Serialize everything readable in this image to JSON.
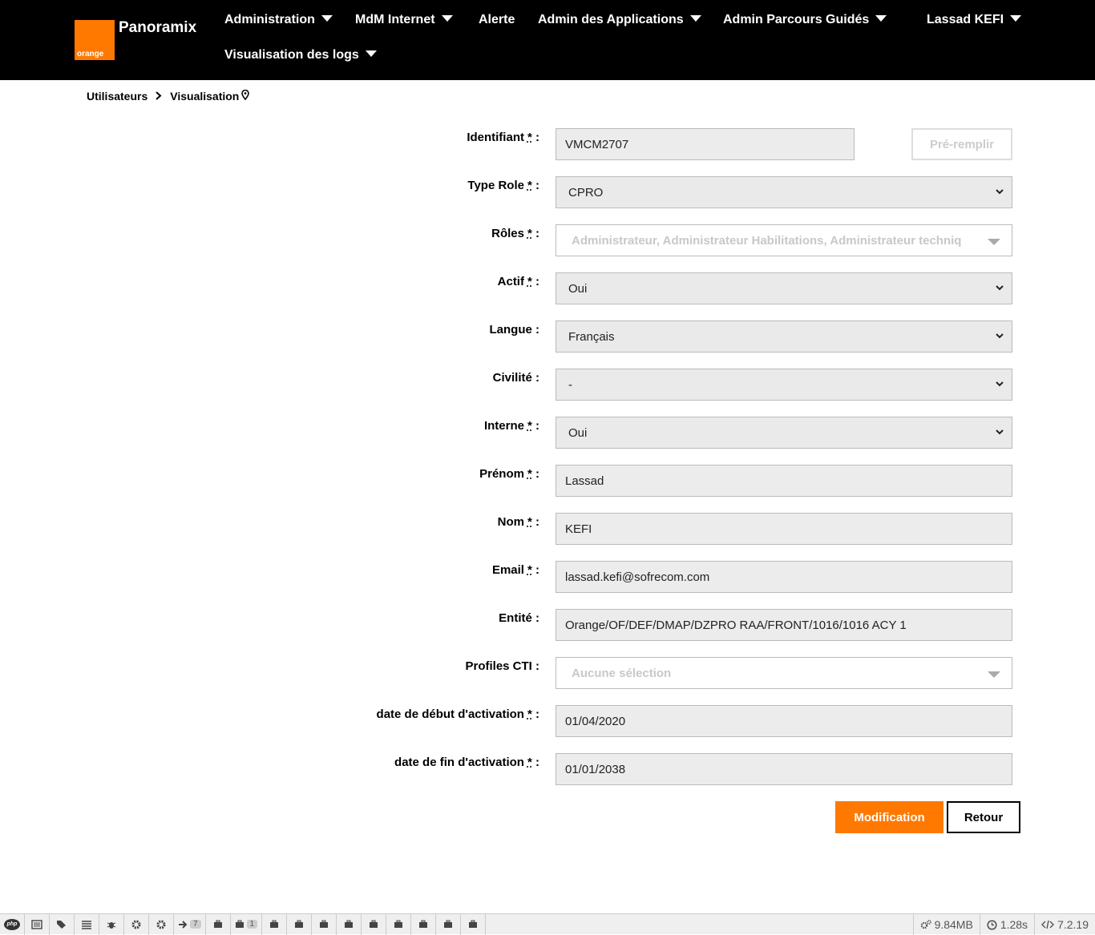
{
  "header": {
    "logo_text": "orange",
    "brand": "Panoramix",
    "nav": [
      {
        "label": "Administration"
      },
      {
        "label": "MdM Internet"
      },
      {
        "label": "Alerte"
      },
      {
        "label": "Admin des Applications"
      },
      {
        "label": "Admin Parcours Guidés"
      },
      {
        "label": "Lassad KEFI"
      },
      {
        "label": "Visualisation des logs"
      }
    ]
  },
  "breadcrumb": {
    "parent": "Utilisateurs",
    "current": "Visualisation"
  },
  "form": {
    "required_mark": "*",
    "fields": {
      "identifiant": {
        "label": "Identifiant",
        "value": "VMCM2707"
      },
      "type_role": {
        "label": "Type Role",
        "value": "CPRO"
      },
      "roles": {
        "label": "Rôles",
        "value": "Administrateur, Administrateur Habilitations, Administrateur techniq"
      },
      "actif": {
        "label": "Actif",
        "value": "Oui"
      },
      "langue": {
        "label": "Langue :",
        "value": "Français"
      },
      "civilite": {
        "label": "Civilité :",
        "value": "-"
      },
      "interne": {
        "label": "Interne",
        "value": "Oui"
      },
      "prenom": {
        "label": "Prénom",
        "value": "Lassad"
      },
      "nom": {
        "label": "Nom",
        "value": "KEFI"
      },
      "email": {
        "label": "Email",
        "value": "lassad.kefi@sofrecom.com"
      },
      "entite": {
        "label": "Entité :",
        "value": "Orange/OF/DEF/DMAP/DZPRO RAA/FRONT/1016/1016 ACY 1"
      },
      "profiles_cti": {
        "label": "Profiles CTI :",
        "value": "Aucune sélection"
      },
      "date_debut": {
        "label": "date de début d'activation",
        "value": "01/04/2020"
      },
      "date_fin": {
        "label": "date de fin d'activation",
        "value": "01/01/2038"
      }
    },
    "colon": ":",
    "prefill_button": "Pré-remplir",
    "submit_button": "Modification",
    "back_button": "Retour"
  },
  "debugbar": {
    "php_label": "php",
    "badge_arrow": "7",
    "badge_box": "1",
    "memory": "9.84MB",
    "time": "1.28s",
    "version": "7.2.19"
  },
  "colors": {
    "accent": "#ff7900",
    "topbar": "#000000",
    "field_bg": "#ececec"
  }
}
